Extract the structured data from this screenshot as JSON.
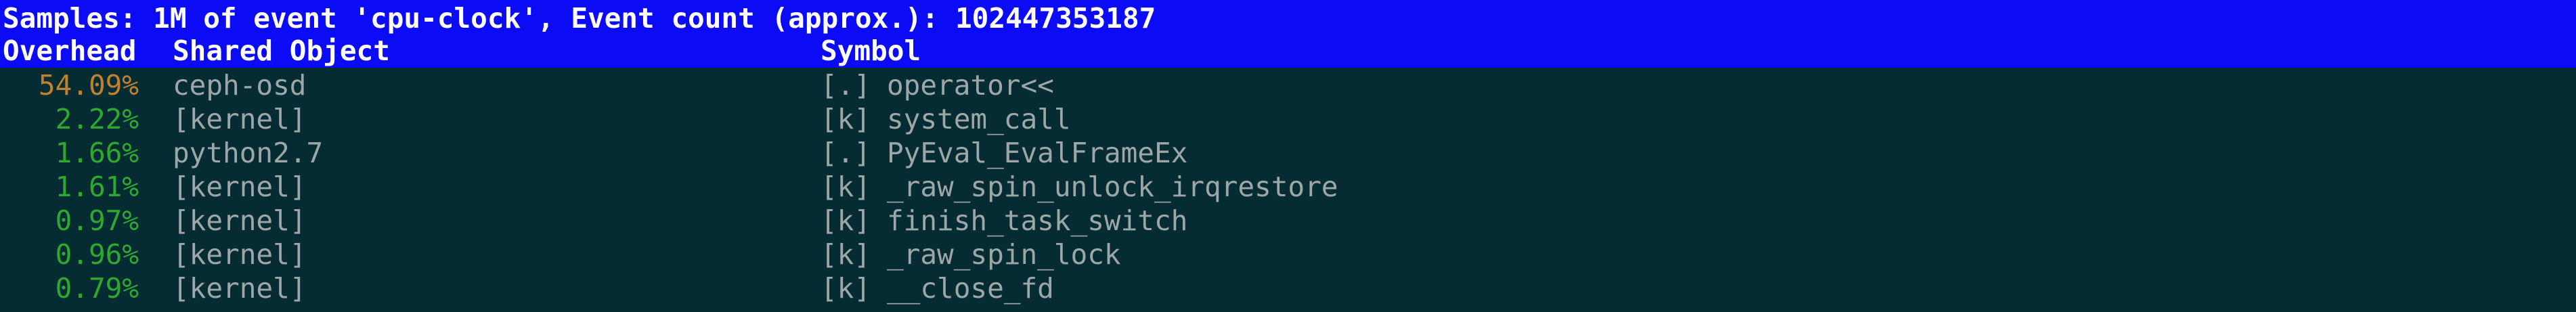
{
  "header": {
    "summary": "Samples: 1M of event 'cpu-clock', Event count (approx.): 102447353187",
    "columns": {
      "overhead": "Overhead",
      "shared_object": "Shared Object",
      "symbol": "Symbol"
    }
  },
  "colors": {
    "background": "#062c33",
    "header_bar": "#0b0bf5",
    "hot": "#c0812f",
    "warm": "#2fa82f",
    "text": "#9ea7a8"
  },
  "rows": [
    {
      "overhead": "54.09%",
      "heat": "hot",
      "object": "ceph-osd",
      "kind": "[.]",
      "symbol": "operator<<"
    },
    {
      "overhead": "2.22%",
      "heat": "warm",
      "object": "[kernel]",
      "kind": "[k]",
      "symbol": "system_call"
    },
    {
      "overhead": "1.66%",
      "heat": "warm",
      "object": "python2.7",
      "kind": "[.]",
      "symbol": "PyEval_EvalFrameEx"
    },
    {
      "overhead": "1.61%",
      "heat": "warm",
      "object": "[kernel]",
      "kind": "[k]",
      "symbol": "_raw_spin_unlock_irqrestore"
    },
    {
      "overhead": "0.97%",
      "heat": "warm",
      "object": "[kernel]",
      "kind": "[k]",
      "symbol": "finish_task_switch"
    },
    {
      "overhead": "0.96%",
      "heat": "warm",
      "object": "[kernel]",
      "kind": "[k]",
      "symbol": "_raw_spin_lock"
    },
    {
      "overhead": "0.79%",
      "heat": "warm",
      "object": "[kernel]",
      "kind": "[k]",
      "symbol": "__close_fd"
    }
  ]
}
